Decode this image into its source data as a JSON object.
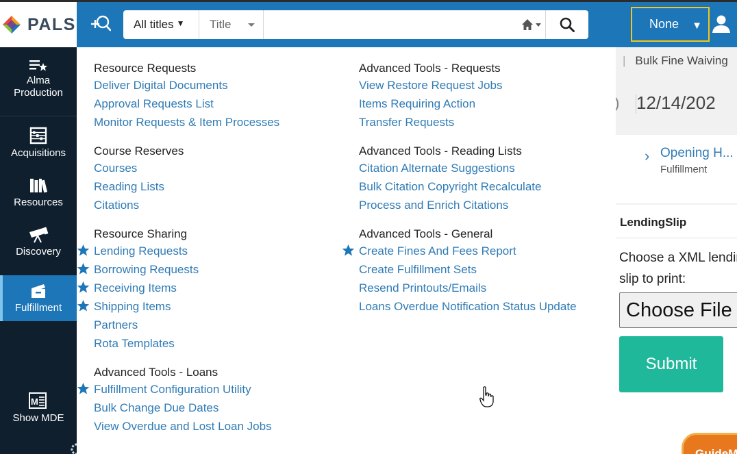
{
  "header": {
    "logo_text": "PALS",
    "search_scope": "All titles",
    "search_field": "Title",
    "search_query": "",
    "institution_selector": "None"
  },
  "leftnav": {
    "items": [
      {
        "label": "Alma\nProduction",
        "icon": "alma-star-icon"
      },
      {
        "label": "Acquisitions",
        "icon": "abacus-icon"
      },
      {
        "label": "Resources",
        "icon": "books-icon"
      },
      {
        "label": "Discovery",
        "icon": "telescope-icon"
      },
      {
        "label": "Fulfillment",
        "icon": "box-icon",
        "active": true
      },
      {
        "label": "Show MDE",
        "icon": "mde-icon"
      }
    ]
  },
  "menu": {
    "col1": [
      {
        "title": "Resource Requests",
        "links": [
          {
            "label": "Deliver Digital Documents",
            "star": false
          },
          {
            "label": "Approval Requests List",
            "star": false
          },
          {
            "label": "Monitor Requests & Item Processes",
            "star": false
          }
        ]
      },
      {
        "title": "Course Reserves",
        "links": [
          {
            "label": "Courses",
            "star": false
          },
          {
            "label": "Reading Lists",
            "star": false
          },
          {
            "label": "Citations",
            "star": false
          }
        ]
      },
      {
        "title": "Resource Sharing",
        "links": [
          {
            "label": "Lending Requests",
            "star": true
          },
          {
            "label": "Borrowing Requests",
            "star": true
          },
          {
            "label": "Receiving Items",
            "star": true
          },
          {
            "label": "Shipping Items",
            "star": true
          },
          {
            "label": "Partners",
            "star": false
          },
          {
            "label": "Rota Templates",
            "star": false
          }
        ]
      },
      {
        "title": "Advanced Tools - Loans",
        "links": [
          {
            "label": "Fulfillment Configuration Utility",
            "star": true
          },
          {
            "label": "Bulk Change Due Dates",
            "star": false
          },
          {
            "label": "View Overdue and Lost Loan Jobs",
            "star": false
          }
        ]
      }
    ],
    "col2": [
      {
        "title": "Advanced Tools - Requests",
        "links": [
          {
            "label": "View Restore Request Jobs",
            "star": false
          },
          {
            "label": "Items Requiring Action",
            "star": false
          },
          {
            "label": "Transfer Requests",
            "star": false
          }
        ]
      },
      {
        "title": "Advanced Tools - Reading Lists",
        "links": [
          {
            "label": "Citation Alternate Suggestions",
            "star": false
          },
          {
            "label": "Bulk Citation Copyright Recalculate",
            "star": false
          },
          {
            "label": "Process and Enrich Citations",
            "star": false
          }
        ]
      },
      {
        "title": "Advanced Tools - General",
        "links": [
          {
            "label": "Create Fines And Fees Report",
            "star": true
          },
          {
            "label": "Create Fulfillment Sets",
            "star": false
          },
          {
            "label": "Resend Printouts/Emails",
            "star": false
          },
          {
            "label": "Loans Overdue Notification Status Update",
            "star": false
          }
        ]
      }
    ]
  },
  "background_page": {
    "breadcrumb": "Bulk Fine Waiving",
    "date": "12/14/202",
    "card_title": "Opening H...",
    "card_subtitle": "Fulfillment",
    "section_title": "LendingSlip",
    "prompt": "Choose a XML lending slip to print:",
    "choose_file_label": "Choose File",
    "submit_label": "Submit",
    "guide_label": "GuideMe"
  },
  "colors": {
    "header_blue": "#1d76b7",
    "nav_dark": "#0f1f2e",
    "link_blue": "#2f7bb5",
    "highlight_yellow": "#f5c518",
    "submit_green": "#1fb89a",
    "guide_orange": "#e8781e"
  }
}
